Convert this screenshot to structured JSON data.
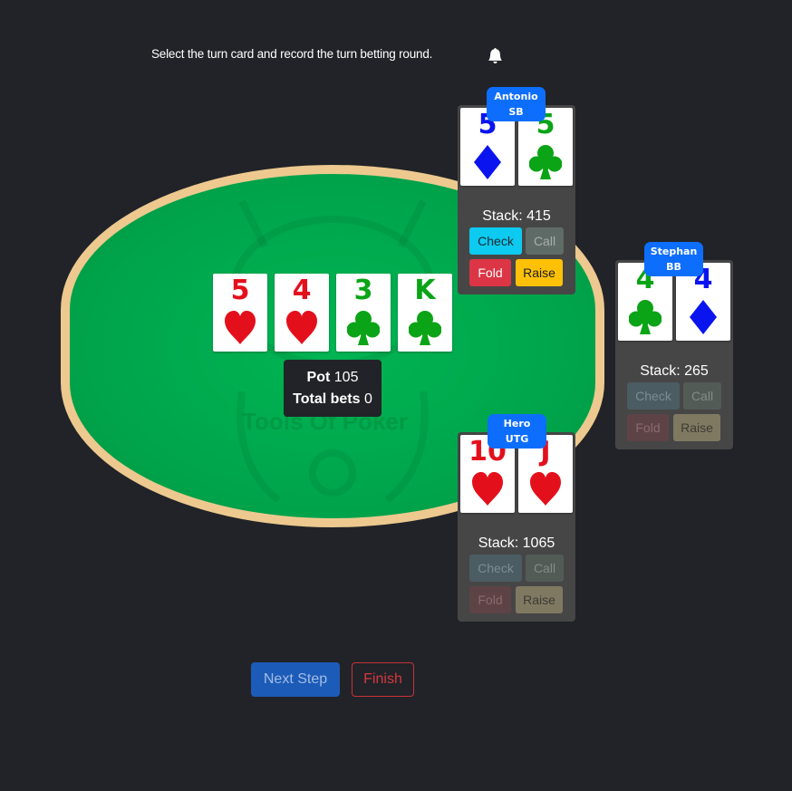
{
  "instruction": "Select the turn card and record the turn betting round.",
  "icons": {
    "bell": "bell-icon"
  },
  "colors": {
    "background": "#212328",
    "felt": "#00a44b",
    "rim": "#edc98f",
    "badge": "#0d6efd",
    "heart": "#e3101c",
    "club": "#0aa416",
    "diamond": "#0a14ef"
  },
  "table": {
    "watermark": "Tools Of Poker",
    "board": [
      {
        "rank": "5",
        "suit": "heart"
      },
      {
        "rank": "4",
        "suit": "heart"
      },
      {
        "rank": "3",
        "suit": "club"
      },
      {
        "rank": "K",
        "suit": "club"
      }
    ],
    "pot": {
      "label": "Pot",
      "value": "105",
      "total_bets_label": "Total bets",
      "total_bets_value": "0"
    }
  },
  "players": {
    "antonio": {
      "name": "Antonio",
      "position": "SB",
      "cards": [
        {
          "rank": "5",
          "suit": "diamond"
        },
        {
          "rank": "5",
          "suit": "club"
        }
      ],
      "stack_label": "Stack: 415",
      "actions": {
        "check": "Check",
        "call": "Call",
        "fold": "Fold",
        "raise": "Raise"
      },
      "active": true
    },
    "stephan": {
      "name": "Stephan",
      "position": "BB",
      "cards": [
        {
          "rank": "4",
          "suit": "club"
        },
        {
          "rank": "4",
          "suit": "diamond"
        }
      ],
      "stack_label": "Stack: 265",
      "actions": {
        "check": "Check",
        "call": "Call",
        "fold": "Fold",
        "raise": "Raise"
      },
      "active": false
    },
    "hero": {
      "name": "Hero",
      "position": "UTG",
      "cards": [
        {
          "rank": "10",
          "suit": "heart"
        },
        {
          "rank": "J",
          "suit": "heart"
        }
      ],
      "stack_label": "Stack: 1065",
      "actions": {
        "check": "Check",
        "call": "Call",
        "fold": "Fold",
        "raise": "Raise"
      },
      "active": false
    }
  },
  "footer": {
    "next_label": "Next Step",
    "finish_label": "Finish"
  }
}
